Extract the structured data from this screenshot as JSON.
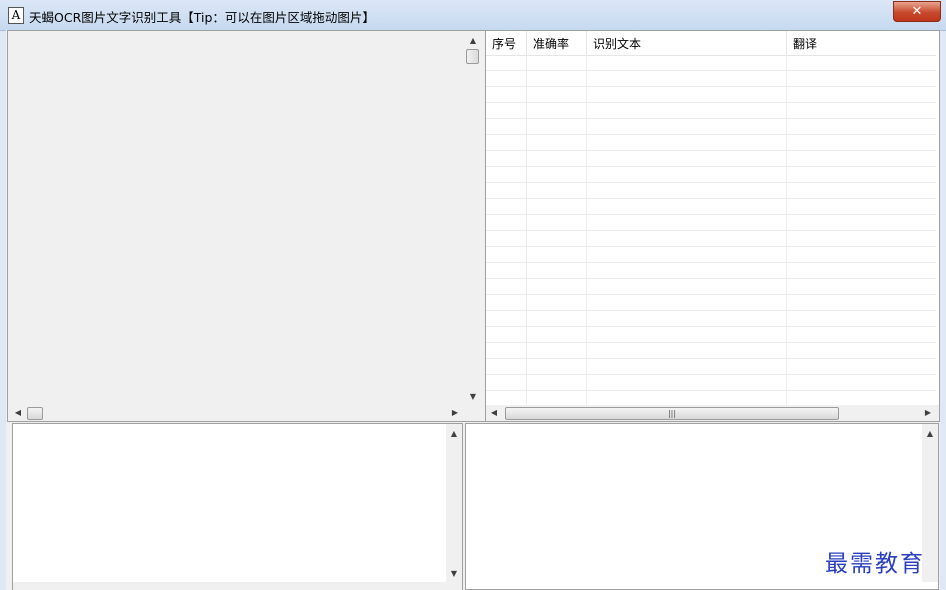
{
  "window": {
    "title": "天蝎OCR图片文字识别工具【Tip：可以在图片区域拖动图片】",
    "app_icon_glyph": "A",
    "close_glyph": "✕"
  },
  "table": {
    "columns": [
      "序号",
      "准确率",
      "识别文本",
      "翻译"
    ],
    "rows": []
  },
  "scrollbars": {
    "up_glyph": "▲",
    "down_glyph": "▼",
    "left_glyph": "◀",
    "right_glyph": "▶",
    "grip_glyph": "|||"
  },
  "watermark": "最需教育"
}
